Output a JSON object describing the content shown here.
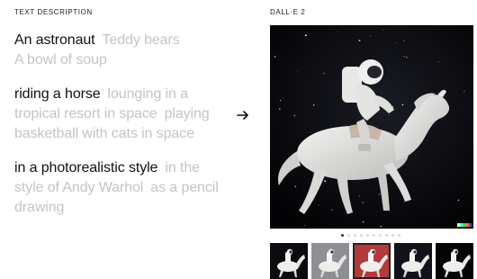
{
  "left": {
    "section_label": "TEXT DESCRIPTION",
    "groups": [
      {
        "selected": "An astronaut",
        "alternatives": [
          "Teddy bears",
          "A bowl of soup"
        ]
      },
      {
        "selected": "riding a horse",
        "alternatives": [
          "lounging in a tropical resort in space",
          "playing basketball with cats in space"
        ]
      },
      {
        "selected": "in a photorealistic style",
        "alternatives": [
          "in the style of Andy Warhol",
          "as a pencil drawing"
        ]
      }
    ]
  },
  "arrow_icon": "arrow-right-icon",
  "right": {
    "section_label": "DALL·E 2",
    "main_image": "astronaut-riding-horse-in-space",
    "signature_colors": [
      "#ffff66",
      "#42ffff",
      "#51da4c",
      "#ff6e3c",
      "#3c46ff"
    ],
    "carousel": {
      "count": 10,
      "active_index": 0
    },
    "thumbnails": [
      {
        "name": "thumb-astronaut-horse-space",
        "bg": "#0c0c10",
        "selected": false
      },
      {
        "name": "thumb-astronaut-horse-grey",
        "bg": "#8d8f95",
        "selected": false
      },
      {
        "name": "thumb-astronaut-horse-red",
        "bg": "#b33a3a",
        "selected": true
      },
      {
        "name": "thumb-astronaut-horse-dark",
        "bg": "#12131a",
        "selected": false
      },
      {
        "name": "thumb-astronaut-horse-black",
        "bg": "#050505",
        "selected": false
      }
    ]
  }
}
